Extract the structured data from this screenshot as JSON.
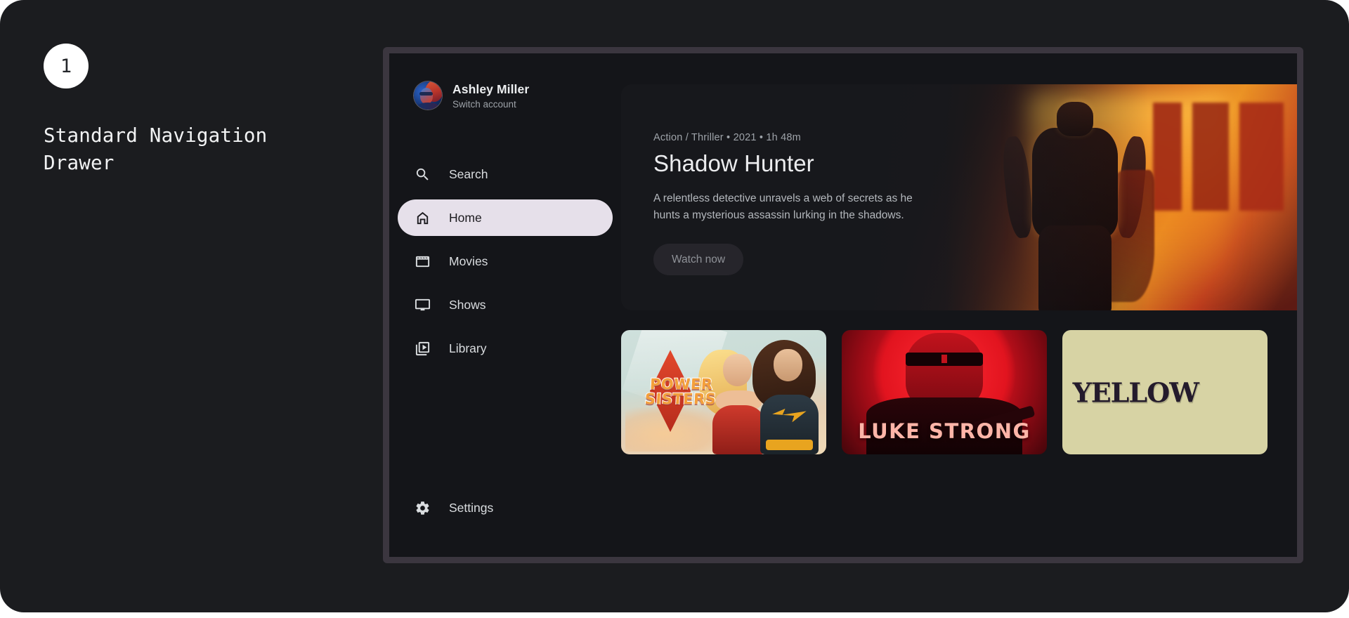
{
  "annotation": {
    "step_number": "1",
    "title": "Standard Navigation Drawer"
  },
  "drawer": {
    "account": {
      "name": "Ashley Miller",
      "switch_label": "Switch account",
      "avatar_icon": "user-avatar-portrait"
    },
    "items": [
      {
        "label": "Search",
        "icon": "search-icon",
        "active": false
      },
      {
        "label": "Home",
        "icon": "home-icon",
        "active": true
      },
      {
        "label": "Movies",
        "icon": "clapperboard-icon",
        "active": false
      },
      {
        "label": "Shows",
        "icon": "tv-icon",
        "active": false
      },
      {
        "label": "Library",
        "icon": "video-library-icon",
        "active": false
      }
    ],
    "footer_item": {
      "label": "Settings",
      "icon": "gear-icon"
    }
  },
  "hero": {
    "meta": "Action / Thriller • 2021 • 1h 48m",
    "title": "Shadow Hunter",
    "description": "A relentless detective unravels a web of secrets as he hunts a mysterious assassin lurking in the shadows.",
    "cta_label": "Watch now",
    "artwork_alt": "muscular-hero-silhouette-orange-sunset"
  },
  "posters": [
    {
      "title_line1": "POWER",
      "title_line2": "SISTERS",
      "art_alt": "two-superheroines-sky-background"
    },
    {
      "title": "LUKE STRONG",
      "art_alt": "sunglasses-man-red-sun-poster"
    },
    {
      "title": "YELLOW",
      "art_alt": "khaki-poster-serif-title"
    }
  ],
  "colors": {
    "page_background": "#1b1c1f",
    "device_frame": "#3b363f",
    "screen_background": "#141519",
    "active_pill": "#e6e0ea",
    "active_pill_text": "#1c1b1f",
    "nav_text": "#dadde0",
    "muted_text": "#9da2a8",
    "hero_accent_orange": "#e08a22",
    "poster_luke_red": "#cf111d",
    "poster_yellow_khaki": "#d7d3a4"
  }
}
